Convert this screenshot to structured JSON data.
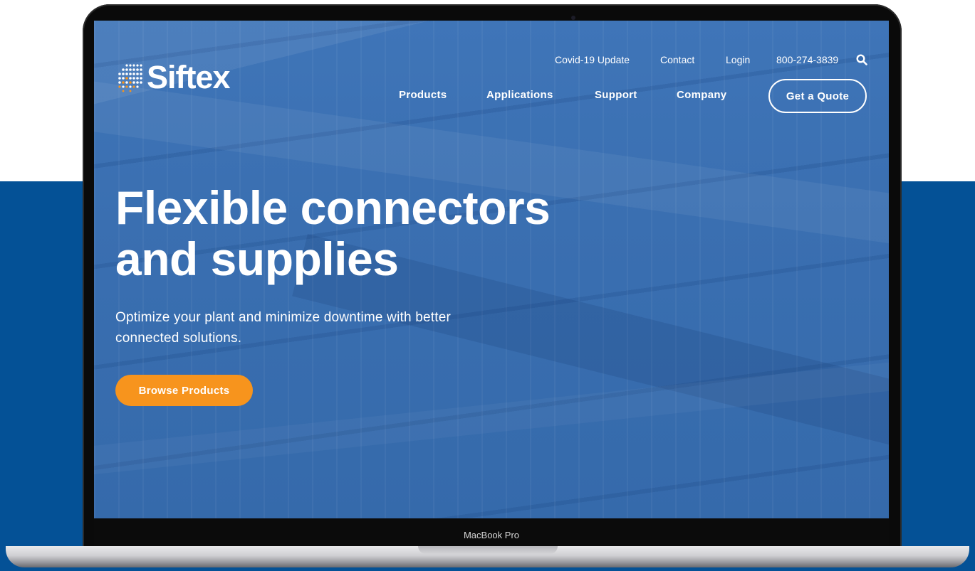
{
  "device": {
    "chin_label": "MacBook Pro"
  },
  "brand": {
    "name": "Siftex",
    "logo_dot_colors": [
      "#ffffff",
      "#f7941d"
    ]
  },
  "top_nav": {
    "covid": "Covid-19 Update",
    "contact": "Contact",
    "login": "Login",
    "phone": "800-274-3839",
    "search_icon": "search-icon"
  },
  "main_nav": {
    "products": "Products",
    "applications": "Applications",
    "support": "Support",
    "company": "Company",
    "quote": "Get a Quote"
  },
  "hero": {
    "title_line1": "Flexible connectors",
    "title_line2": "and supplies",
    "subtitle_line1": "Optimize your plant and minimize downtime with better",
    "subtitle_line2": "connected solutions.",
    "cta": "Browse Products"
  },
  "colors": {
    "hero_blue": "#3a6fb1",
    "page_blue": "#045196",
    "cta_orange": "#f7941d"
  }
}
